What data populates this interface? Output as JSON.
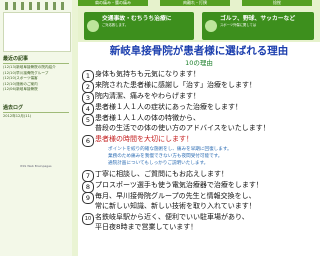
{
  "sidebar": {
    "recent_title": "最近の記事",
    "recent_items": [
      "(12/13)新岐阜接骨院の院内紹介",
      "(12/10)早川接骨院グループ",
      "(12/10)スポーツ傷害",
      "(12/10)施術のご案内",
      "(12/06)新岐阜接骨院"
    ],
    "archive_title": "過去ログ",
    "archive_items": [
      "2012年12月(11)"
    ],
    "powered": "RSS Web Brainpages"
  },
  "nav": {
    "left": "肩の痛み・腰の痛み",
    "mid": "肉離れ・打撲",
    "right": "捻挫"
  },
  "banners": [
    {
      "title": "交通事故・むちうち治療に",
      "sub": "ご対応致します。",
      "small": "交通事故・後遺障害の保険相談もお任せ下さい"
    },
    {
      "title": "ゴルフ、野球、サッカーなど",
      "sub": "スポーツ外傷に関しては",
      "small": ""
    }
  ],
  "main": {
    "title": "新岐阜接骨院が患者様に選ばれる理由",
    "subtitle": "10の理由",
    "reasons": [
      {
        "num": "1",
        "text": "身体も気持ちも元気になります！"
      },
      {
        "num": "2",
        "text": "来院された患者様に感謝し「治す」治療をします！"
      },
      {
        "num": "3",
        "text": "院内清潔、痛みをやわらげます！"
      },
      {
        "num": "4",
        "text": "患者様１人１人の症状にあった治療をします！"
      },
      {
        "num": "5",
        "text": "患者様１人１人の体の特徴から、"
      },
      {
        "num": "",
        "text": "普段の生活での体の使い方のアドバイスをいたします！"
      },
      {
        "num": "6",
        "text": "患者様の時間を大切にします！"
      },
      {
        "num": "7",
        "text": "丁寧に相談し、ご質問にもお応えします！"
      },
      {
        "num": "8",
        "text": "プロスポーツ選手も使う電気治療器で治療をします！"
      },
      {
        "num": "9",
        "text": "毎月、早川接骨院グループの先生と情報交換をし、"
      },
      {
        "num": "",
        "text": "常に新しい知識、新しい技術を取り入れています！"
      },
      {
        "num": "10",
        "text": "名鉄岐阜駅から近く、便利でいい駐車場があり、"
      },
      {
        "num": "",
        "text": "平日夜8時まで営業しています！"
      }
    ],
    "notes": [
      "ポイントを絞り的確な施術をし、痛みを早期に回復します。",
      "業務のため痛みを我慢できない方も夜間受付可能です。",
      "通院計画についてもしっかりご説明いたします。"
    ]
  }
}
